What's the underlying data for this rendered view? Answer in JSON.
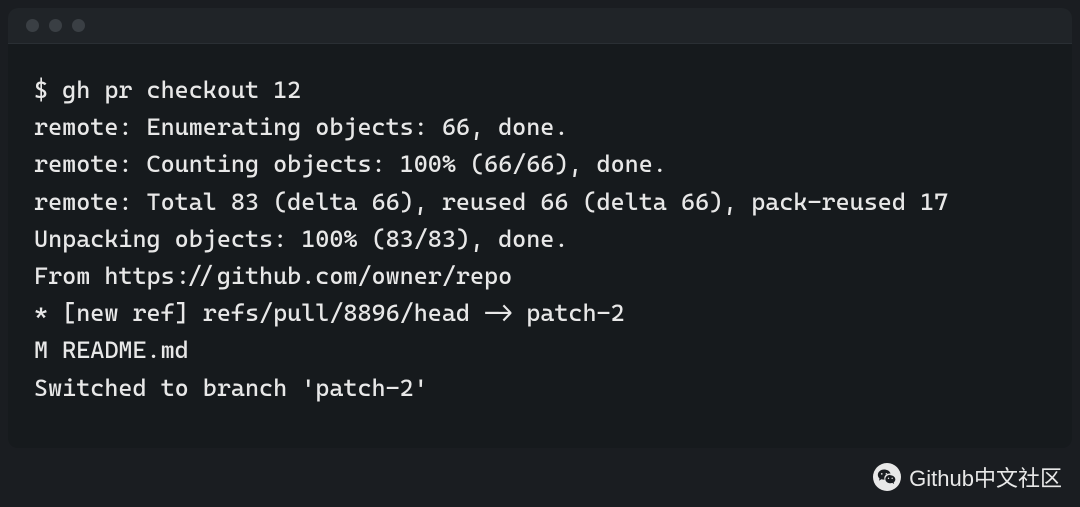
{
  "terminal": {
    "prompt": "$ ",
    "command": "gh pr checkout 12",
    "output": [
      "remote: Enumerating objects: 66, done.",
      "remote: Counting objects: 100% (66/66), done.",
      "remote: Total 83 (delta 66), reused 66 (delta 66), pack-reused 17",
      "Unpacking objects: 100% (83/83), done.",
      "From https://github.com/owner/repo",
      "* [new ref] refs/pull/8896/head -> patch-2",
      "M README.md",
      "Switched to branch 'patch-2'"
    ]
  },
  "watermark": {
    "label": "Github中文社区",
    "icon": "wechat-icon"
  }
}
